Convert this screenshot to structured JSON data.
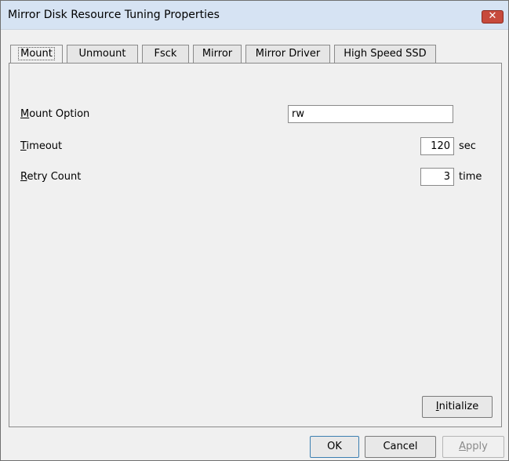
{
  "window": {
    "title": "Mirror Disk Resource Tuning Properties",
    "close_glyph": "✕"
  },
  "tabs": [
    {
      "label": "Mount",
      "active": true
    },
    {
      "label": "Unmount"
    },
    {
      "label": "Fsck"
    },
    {
      "label": "Mirror"
    },
    {
      "label": "Mirror Driver"
    },
    {
      "label": "High Speed SSD"
    }
  ],
  "mount": {
    "mount_option": {
      "mnemonic": "M",
      "rest": "ount Option",
      "value": "rw"
    },
    "timeout": {
      "mnemonic": "T",
      "rest": "imeout",
      "value": "120",
      "unit": "sec"
    },
    "retry_count": {
      "mnemonic": "R",
      "rest": "etry Count",
      "value": "3",
      "unit": "time"
    },
    "initialize": {
      "mnemonic": "I",
      "rest": "nitialize"
    }
  },
  "footer": {
    "ok_label": "OK",
    "cancel_label": "Cancel",
    "apply": {
      "mnemonic": "A",
      "rest": "pply"
    }
  }
}
